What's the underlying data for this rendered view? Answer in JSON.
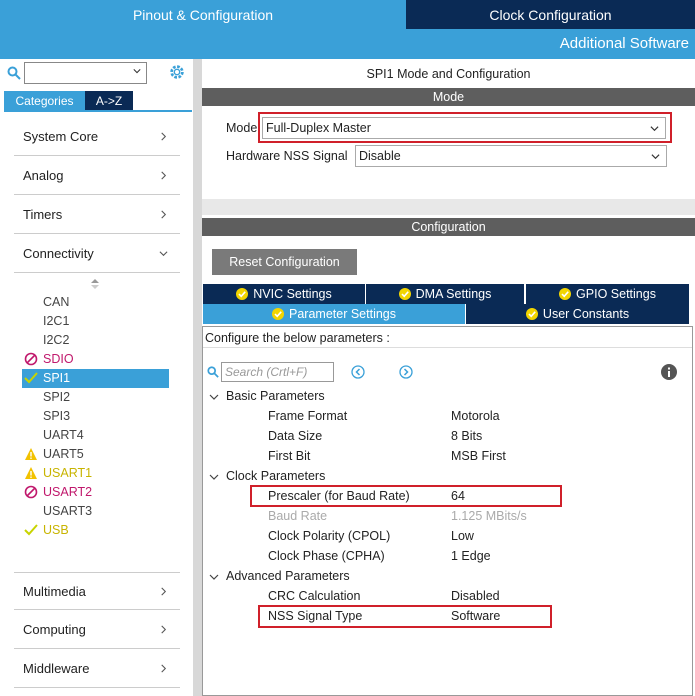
{
  "tabs": {
    "pinout": "Pinout & Configuration",
    "clock": "Clock Configuration",
    "additional": "Additional Software"
  },
  "left": {
    "search_value": "",
    "tab_categories": "Categories",
    "tab_az": "A->Z",
    "categories": [
      {
        "label": "System Core",
        "expanded": false
      },
      {
        "label": "Analog",
        "expanded": false
      },
      {
        "label": "Timers",
        "expanded": false
      },
      {
        "label": "Connectivity",
        "expanded": true
      },
      {
        "label": "Multimedia",
        "expanded": false
      },
      {
        "label": "Computing",
        "expanded": false
      },
      {
        "label": "Middleware",
        "expanded": false
      }
    ],
    "peripherals": [
      {
        "label": "CAN",
        "status": "none"
      },
      {
        "label": "I2C1",
        "status": "none"
      },
      {
        "label": "I2C2",
        "status": "none"
      },
      {
        "label": "SDIO",
        "status": "disabled"
      },
      {
        "label": "SPI1",
        "status": "ok"
      },
      {
        "label": "SPI2",
        "status": "none"
      },
      {
        "label": "SPI3",
        "status": "none"
      },
      {
        "label": "UART4",
        "status": "none"
      },
      {
        "label": "UART5",
        "status": "warning"
      },
      {
        "label": "USART1",
        "status": "warning"
      },
      {
        "label": "USART2",
        "status": "disabled"
      },
      {
        "label": "USART3",
        "status": "none"
      },
      {
        "label": "USB",
        "status": "ok"
      }
    ]
  },
  "right": {
    "title": "SPI1 Mode and Configuration",
    "mode_header": "Mode",
    "mode_label": "Mode",
    "mode_value": "Full-Duplex Master",
    "nss_label": "Hardware NSS Signal",
    "nss_value": "Disable",
    "config_header": "Configuration",
    "reset_button": "Reset Configuration",
    "settings_tabs": [
      "NVIC Settings",
      "DMA Settings",
      "GPIO Settings",
      "Parameter Settings",
      "User Constants"
    ],
    "configure_text": "Configure the below parameters :",
    "search_placeholder": "Search (Crtl+F)",
    "groups": [
      {
        "name": "Basic Parameters",
        "params": [
          {
            "name": "Frame Format",
            "value": "Motorola"
          },
          {
            "name": "Data Size",
            "value": "8 Bits"
          },
          {
            "name": "First Bit",
            "value": "MSB First"
          }
        ]
      },
      {
        "name": "Clock Parameters",
        "params": [
          {
            "name": "Prescaler (for Baud Rate)",
            "value": "64"
          },
          {
            "name": "Baud Rate",
            "value": "1.125 MBits/s"
          },
          {
            "name": "Clock Polarity (CPOL)",
            "value": "Low"
          },
          {
            "name": "Clock Phase (CPHA)",
            "value": "1 Edge"
          }
        ]
      },
      {
        "name": "Advanced Parameters",
        "params": [
          {
            "name": "CRC Calculation",
            "value": "Disabled"
          },
          {
            "name": "NSS Signal Type",
            "value": "Software"
          }
        ]
      }
    ]
  },
  "colors": {
    "accent": "#3aa0d8",
    "dark": "#0a2a55",
    "highlight": "#d0202a",
    "pink": "#c0186c",
    "yellow": "#c8b400",
    "green": "#8cc63f"
  }
}
